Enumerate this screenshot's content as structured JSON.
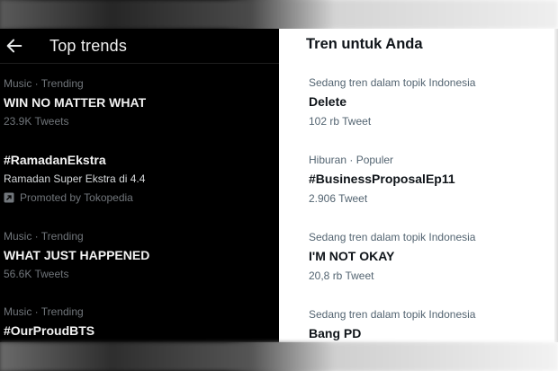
{
  "left": {
    "title": "Top trends",
    "trends": [
      {
        "meta": "Music · Trending",
        "name": "WIN NO MATTER WHAT",
        "count": "23.9K Tweets"
      },
      {
        "name": "#RamadanEkstra",
        "subtitle": "Ramadan Super Ekstra di 4.4",
        "promoted": "Promoted by Tokopedia"
      },
      {
        "meta": "Music · Trending",
        "name": "WHAT JUST HAPPENED",
        "count": "56.6K Tweets"
      },
      {
        "meta": "Music · Trending",
        "name": "#OurProudBTS"
      }
    ]
  },
  "right": {
    "title": "Tren untuk Anda",
    "trends": [
      {
        "meta": "Sedang tren dalam topik Indonesia",
        "name": "Delete",
        "count": "102 rb Tweet"
      },
      {
        "meta": "Hiburan · Populer",
        "name": "#BusinessProposalEp11",
        "count": "2.906 Tweet"
      },
      {
        "meta": "Sedang tren dalam topik Indonesia",
        "name": "I'M NOT OKAY",
        "count": "20,8 rb Tweet"
      },
      {
        "meta": "Sedang tren dalam topik Indonesia",
        "name": "Bang PD"
      }
    ]
  },
  "icons": {
    "back": "arrow-left-icon",
    "promoted": "promoted-arrow-icon"
  },
  "colors": {
    "dark_bg": "#000000",
    "light_bg": "#ffffff",
    "muted_dark": "#71767b",
    "muted_light": "#536471"
  }
}
